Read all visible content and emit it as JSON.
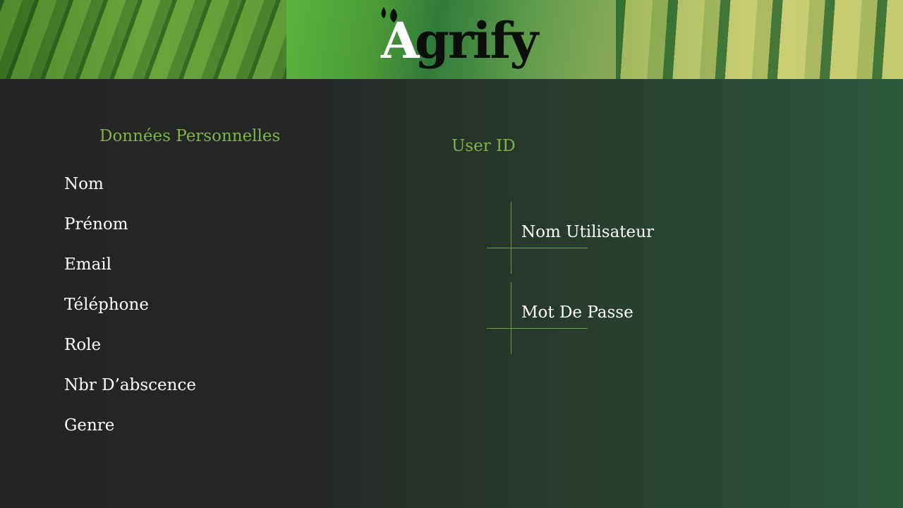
{
  "brand": {
    "logo_text": "Agrify"
  },
  "personal": {
    "heading": "Données Personnelles",
    "fields": [
      {
        "label": "Nom"
      },
      {
        "label": "Prénom"
      },
      {
        "label": "Email"
      },
      {
        "label": "Téléphone"
      },
      {
        "label": "Role"
      },
      {
        "label": "Nbr D’abscence"
      },
      {
        "label": "Genre"
      }
    ]
  },
  "user_id": {
    "heading": "User ID",
    "username_label": "Nom Utilisateur",
    "password_label": "Mot De Passe"
  },
  "colors": {
    "accent": "#7fb446",
    "line": "#6aa33a",
    "text": "#ffffff",
    "bg_left": "#232323",
    "bg_right": "#2c5a3d"
  }
}
